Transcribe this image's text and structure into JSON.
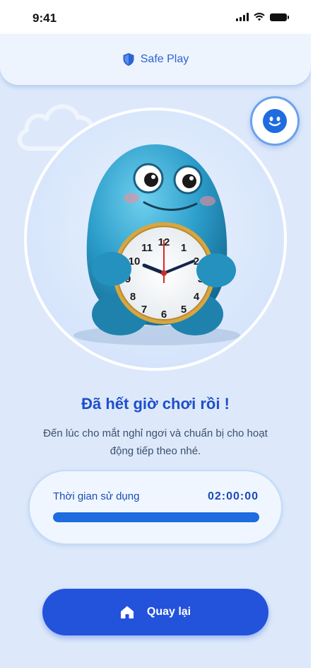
{
  "status_bar": {
    "time": "9:41"
  },
  "header": {
    "title": "Safe Play",
    "icon": "shield-icon"
  },
  "mascot_button": {
    "icon": "smiley-face-icon"
  },
  "hero": {
    "image": "blob-mascot-holding-clock"
  },
  "main": {
    "headline": "Đã hết giờ chơi rồi !",
    "message": "Đến lúc cho mắt nghỉ ngơi và chuẩn bị cho hoạt động tiếp theo nhé."
  },
  "usage": {
    "label": "Thời gian sử dụng",
    "value": "02:00:00",
    "progress": 1.0
  },
  "back_button": {
    "label": "Quay lại",
    "icon": "home-icon"
  },
  "colors": {
    "accent": "#2352db",
    "text_primary": "#1e4fc9",
    "background": "#dde9fb"
  }
}
